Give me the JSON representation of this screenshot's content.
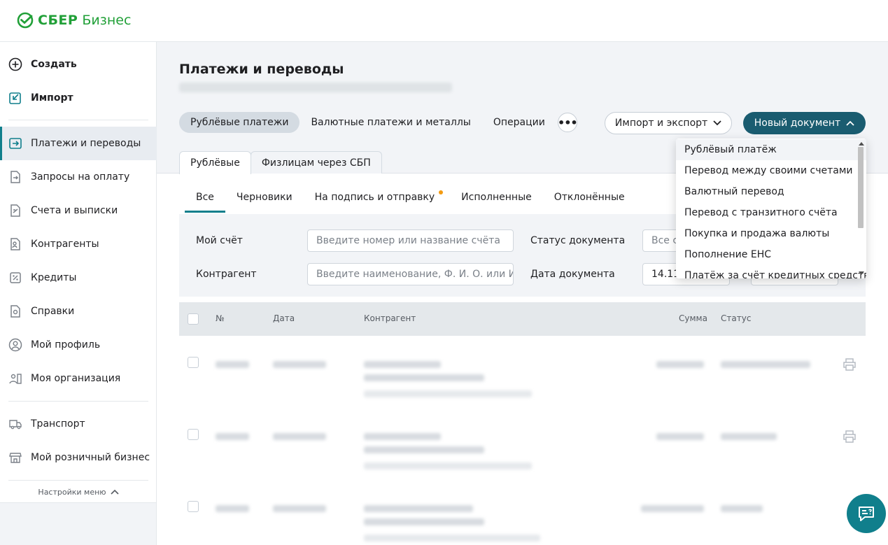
{
  "header": {
    "logo_brand": "СБЕР",
    "logo_suffix": "Бизнес"
  },
  "sidebar": {
    "items": [
      {
        "label": "Создать",
        "icon": "plus-circle-icon"
      },
      {
        "label": "Импорт",
        "icon": "import-icon"
      },
      {
        "label": "Платежи и переводы",
        "icon": "payments-icon"
      },
      {
        "label": "Запросы на оплату",
        "icon": "payment-request-icon"
      },
      {
        "label": "Счета и выписки",
        "icon": "accounts-icon"
      },
      {
        "label": "Контрагенты",
        "icon": "counterparties-icon"
      },
      {
        "label": "Кредиты",
        "icon": "credits-icon"
      },
      {
        "label": "Справки",
        "icon": "certificates-icon"
      },
      {
        "label": "Мой профиль",
        "icon": "profile-icon"
      },
      {
        "label": "Моя организация",
        "icon": "organization-icon"
      },
      {
        "label": "Транспорт",
        "icon": "truck-icon"
      },
      {
        "label": "Мой розничный бизнес",
        "icon": "store-icon"
      }
    ],
    "settings_label": "Настройки меню"
  },
  "main": {
    "title": "Платежи и переводы",
    "tabs": [
      "Рублёвые платежи",
      "Валютные платежи и металлы",
      "Операции"
    ],
    "more_label": "•••",
    "import_export_label": "Импорт и экспорт",
    "new_document_label": "Новый документ",
    "subtabs": [
      "Рублёвые",
      "Физлицам через СБП"
    ],
    "status_tabs": [
      "Все",
      "Черновики",
      "На подпись и отправку",
      "Исполненные",
      "Отклонённые"
    ],
    "filters": {
      "account_label": "Мой счёт",
      "account_placeholder": "Введите номер или название счёта",
      "counterparty_label": "Контрагент",
      "counterparty_placeholder": "Введите наименование, Ф. И. О. или И…",
      "status_label": "Статус документа",
      "status_value": "Все ст",
      "date_label": "Дата документа",
      "date_value": "14.11"
    },
    "table": {
      "columns": [
        "№",
        "Дата",
        "Контрагент",
        "Сумма",
        "Статус"
      ]
    }
  },
  "dropdown": {
    "items": [
      "Рублёвый платёж",
      "Перевод между своими счетами",
      "Валютный перевод",
      "Перевод с транзитного счёта",
      "Покупка и продажа валюты",
      "Пополнение ЕНС",
      "Платёж за счёт кредитных средств"
    ]
  },
  "colors": {
    "brand": "#21a038",
    "accent": "#107f8c",
    "primary_button": "#1a5c70"
  }
}
